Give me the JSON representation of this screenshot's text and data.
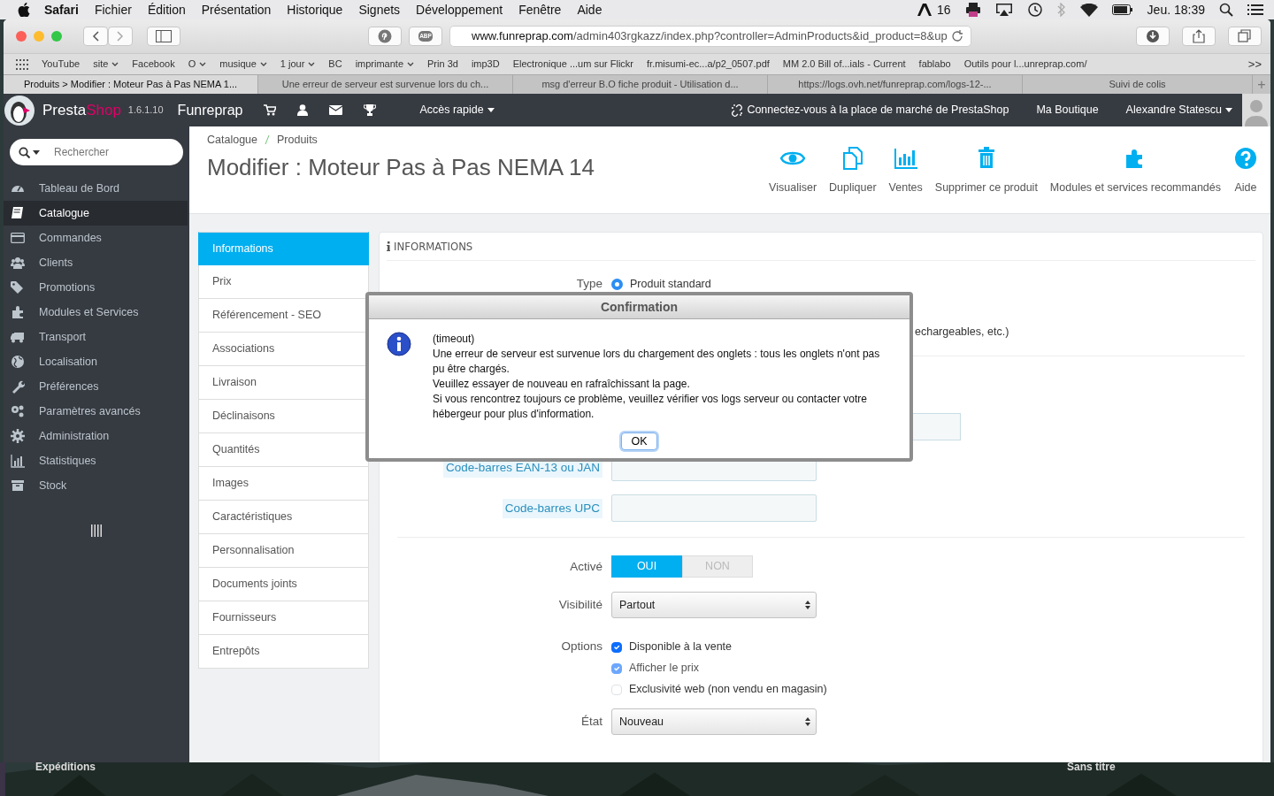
{
  "menu_bar": {
    "app": "Safari",
    "items": [
      "Fichier",
      "Édition",
      "Présentation",
      "Historique",
      "Signets",
      "Développement",
      "Fenêtre",
      "Aide"
    ],
    "badge_count": "16",
    "clock": "Jeu. 18:39"
  },
  "browser": {
    "extension_label": "ABP",
    "url_host": "www.funreprap.com",
    "url_path": "/admin403rgkazz/index.php?controller=AdminProducts&id_product=8&up",
    "bookmarks": [
      {
        "label": "YouTube",
        "folder": false
      },
      {
        "label": "site",
        "folder": true
      },
      {
        "label": "Facebook",
        "folder": false
      },
      {
        "label": "O",
        "folder": true
      },
      {
        "label": "musique",
        "folder": true
      },
      {
        "label": "1 jour",
        "folder": true
      },
      {
        "label": "BC",
        "folder": false
      },
      {
        "label": "imprimante",
        "folder": true
      },
      {
        "label": "Prin 3d",
        "folder": false
      },
      {
        "label": "imp3D",
        "folder": false
      },
      {
        "label": "Electronique ...um sur Flickr",
        "folder": false
      },
      {
        "label": "fr.misumi-ec...a/p2_0507.pdf",
        "folder": false
      },
      {
        "label": "MM 2.0 Bill of...ials - Current",
        "folder": false
      },
      {
        "label": "fablabo",
        "folder": false
      },
      {
        "label": "Outils pour l...unreprap.com/",
        "folder": false
      }
    ],
    "more": ">>",
    "tabs": [
      {
        "label": "Produits > Modifier : Moteur Pas à Pas NEMA 1...",
        "selected": true
      },
      {
        "label": "Une erreur de serveur est survenue lors du ch...",
        "selected": false
      },
      {
        "label": "msg d'erreur B.O fiche produit - Utilisation d...",
        "selected": false
      },
      {
        "label": "https://logs.ovh.net/funreprap.com/logs-12-...",
        "selected": false
      },
      {
        "label": "Suivi de colis",
        "selected": false
      }
    ],
    "new_tab": "+"
  },
  "admin_header": {
    "brand_first": "Presta",
    "brand_second": "Shop",
    "version": "1.6.1.10",
    "shop": "Funreprap",
    "quick_access": "Accès rapide",
    "marketplace": "Connectez-vous à la place de marché de PrestaShop",
    "my_shop": "Ma Boutique",
    "user": "Alexandre Statescu"
  },
  "sidebar": {
    "search_placeholder": "Rechercher",
    "items": [
      {
        "label": "Tableau de Bord",
        "selected": false
      },
      {
        "label": "Catalogue",
        "selected": true
      },
      {
        "label": "Commandes",
        "selected": false
      },
      {
        "label": "Clients",
        "selected": false
      },
      {
        "label": "Promotions",
        "selected": false
      },
      {
        "label": "Modules et Services",
        "selected": false
      },
      {
        "label": "Transport",
        "selected": false
      },
      {
        "label": "Localisation",
        "selected": false
      },
      {
        "label": "Préférences",
        "selected": false
      },
      {
        "label": "Paramètres avancés",
        "selected": false
      },
      {
        "label": "Administration",
        "selected": false
      },
      {
        "label": "Statistiques",
        "selected": false
      },
      {
        "label": "Stock",
        "selected": false
      }
    ]
  },
  "breadcrumb": [
    "Catalogue",
    "Produits"
  ],
  "page_title": "Modifier : Moteur Pas à Pas NEMA 14",
  "toolbar": [
    "Visualiser",
    "Dupliquer",
    "Ventes",
    "Supprimer ce produit",
    "Modules et services recommandés",
    "Aide"
  ],
  "product_tabs": [
    {
      "label": "Informations",
      "selected": true
    },
    {
      "label": "Prix",
      "selected": false
    },
    {
      "label": "Référencement - SEO",
      "selected": false
    },
    {
      "label": "Associations",
      "selected": false
    },
    {
      "label": "Livraison",
      "selected": false
    },
    {
      "label": "Déclinaisons",
      "selected": false
    },
    {
      "label": "Quantités",
      "selected": false
    },
    {
      "label": "Images",
      "selected": false
    },
    {
      "label": "Caractéristiques",
      "selected": false
    },
    {
      "label": "Personnalisation",
      "selected": false
    },
    {
      "label": "Documents joints",
      "selected": false
    },
    {
      "label": "Fournisseurs",
      "selected": false
    },
    {
      "label": "Entrepôts",
      "selected": false
    }
  ],
  "panel": {
    "title": "INFORMATIONS",
    "type_label": "Type",
    "type_option": "Produit standard",
    "type_selected": true,
    "cut_text": "echargeables, etc.)",
    "barcodes": [
      {
        "label": "Code-barres EAN-13 ou JAN"
      },
      {
        "label": "Code-barres UPC"
      }
    ],
    "active": {
      "label": "Activé",
      "on": true,
      "yes": "OUI",
      "no": "NON"
    },
    "visibility": {
      "label": "Visibilité",
      "value": "Partout"
    },
    "options": {
      "label": "Options",
      "items": [
        {
          "label": "Disponible à la vente",
          "checked": true,
          "disabled": false
        },
        {
          "label": "Afficher le prix",
          "checked": true,
          "disabled": true
        },
        {
          "label": "Exclusivité web (non vendu en magasin)",
          "checked": false,
          "disabled": false
        }
      ]
    },
    "condition": {
      "label": "État",
      "value": "Nouveau"
    }
  },
  "dialog": {
    "title": "Confirmation",
    "lines": [
      "(timeout)",
      "Une erreur de serveur est survenue lors du chargement des onglets : tous les onglets n'ont pas pu être chargés.",
      "Veuillez essayer de nouveau en rafraîchissant la page.",
      "Si vous rencontrez toujours ce problème, veuillez vérifier vos logs serveur ou contacter votre hébergeur pour plus d'information."
    ],
    "button": "OK"
  },
  "desktop": {
    "icons": [
      "Expéditions",
      "Sans titre"
    ]
  }
}
